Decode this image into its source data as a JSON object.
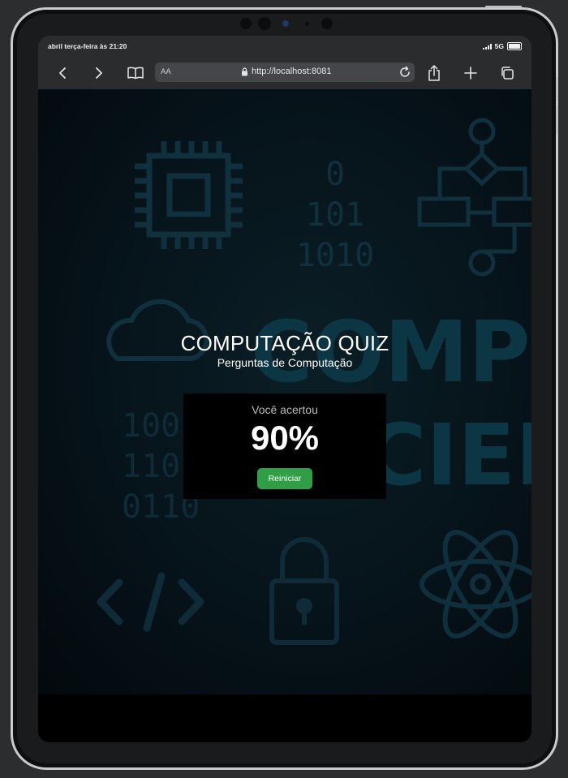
{
  "status_bar": {
    "time": "abril terça-feira às 21:20",
    "network": "5G"
  },
  "browser": {
    "text_size_label": "AA",
    "url": "http://localhost:8081"
  },
  "background_art": {
    "binary_top": [
      "0",
      "101",
      "1010"
    ],
    "binary_left": [
      "100",
      "110",
      "0110"
    ],
    "big_text_line1": "COMPU",
    "big_text_line2": "CIEN"
  },
  "quiz": {
    "title": "COMPUTAÇÃO QUIZ",
    "subtitle": "Perguntas de Computação",
    "result_label": "Você acertou",
    "score": "90%",
    "restart_label": "Reiniciar"
  },
  "colors": {
    "accent_green": "#2f9e45",
    "background": "#06131a",
    "art_stroke": "#123746"
  }
}
